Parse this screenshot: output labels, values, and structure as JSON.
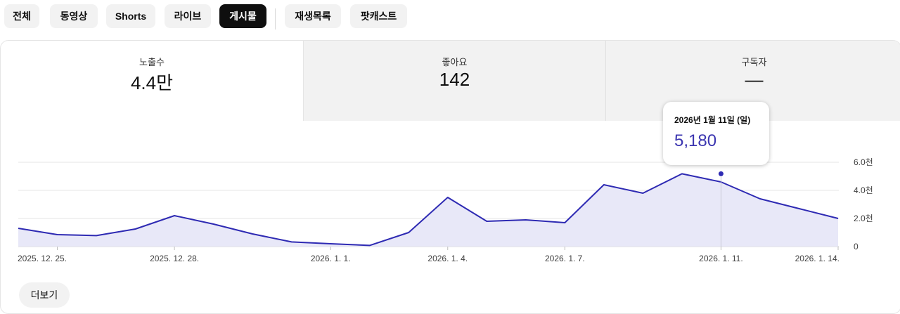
{
  "chips": [
    {
      "label": "전체",
      "selected": false
    },
    {
      "label": "동영상",
      "selected": false
    },
    {
      "label": "Shorts",
      "selected": false
    },
    {
      "label": "라이브",
      "selected": false
    },
    {
      "label": "게시물",
      "selected": true
    },
    {
      "label": "재생목록",
      "selected": false
    },
    {
      "label": "팟캐스트",
      "selected": false
    }
  ],
  "metrics": [
    {
      "label": "노출수",
      "value": "4.4만"
    },
    {
      "label": "좋아요",
      "value": "142"
    },
    {
      "label": "구독자",
      "value": "—"
    }
  ],
  "tooltip": {
    "date": "2026년 1월 11일 (일)",
    "value": "5,180"
  },
  "more_label": "더보기",
  "colors": {
    "line": "#2e2ab3",
    "fill": "#e8e8f8",
    "selected_chip": "#0f0f0f",
    "tooltip_value": "#3b35b0"
  },
  "chart_data": {
    "type": "area",
    "x": [
      "2025-12-24",
      "2025-12-25",
      "2025-12-26",
      "2025-12-27",
      "2025-12-28",
      "2025-12-29",
      "2025-12-30",
      "2025-12-31",
      "2026-01-01",
      "2026-01-02",
      "2026-01-03",
      "2026-01-04",
      "2026-01-05",
      "2026-01-06",
      "2026-01-07",
      "2026-01-08",
      "2026-01-09",
      "2026-01-10",
      "2026-01-11",
      "2026-01-12",
      "2026-01-13",
      "2026-01-14"
    ],
    "values": [
      1300,
      850,
      780,
      1250,
      2200,
      1600,
      900,
      330,
      200,
      80,
      1000,
      3500,
      1800,
      1900,
      1700,
      4400,
      3800,
      5180,
      4600,
      3400,
      2700,
      2000
    ],
    "xticks": [
      {
        "x": "2025-12-25",
        "label": "2025. 12. 25."
      },
      {
        "x": "2025-12-28",
        "label": "2025. 12. 28."
      },
      {
        "x": "2026-01-01",
        "label": "2026. 1. 1."
      },
      {
        "x": "2026-01-04",
        "label": "2026. 1. 4."
      },
      {
        "x": "2026-01-07",
        "label": "2026. 1. 7."
      },
      {
        "x": "2026-01-11",
        "label": "2026. 1. 11."
      },
      {
        "x": "2026-01-14",
        "label": "2026. 1. 14."
      }
    ],
    "yticks": [
      {
        "value": 0,
        "label": "0"
      },
      {
        "value": 2000,
        "label": "2.0천"
      },
      {
        "value": 4000,
        "label": "4.0천"
      },
      {
        "value": 6000,
        "label": "6.0천"
      }
    ],
    "ylim": [
      0,
      6000
    ],
    "highlight": {
      "x": "2026-01-11",
      "value": 5180
    },
    "grid": true
  }
}
